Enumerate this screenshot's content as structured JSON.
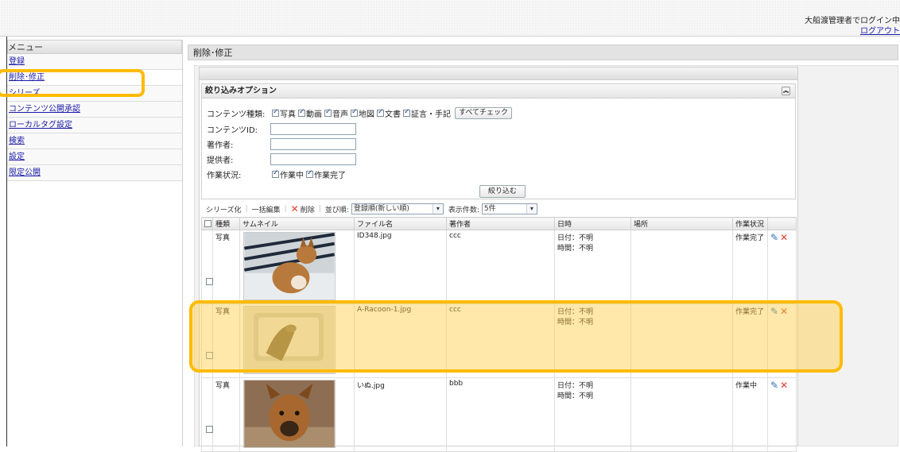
{
  "header": {
    "login_text": "大船渡管理者でログイン中",
    "logout_label": "ログアウト"
  },
  "sidebar": {
    "title": "メニュー",
    "items": [
      {
        "label": "登録"
      },
      {
        "label": "削除･修正"
      },
      {
        "label": "シリーズ"
      },
      {
        "label": "コンテンツ公開承認"
      },
      {
        "label": "ローカルタグ設定"
      },
      {
        "label": "検索"
      },
      {
        "label": "設定"
      },
      {
        "label": "限定公開"
      }
    ]
  },
  "main": {
    "title": "削除･修正"
  },
  "filter": {
    "title": "絞り込みオプション",
    "content_type_label": "コンテンツ種類:",
    "content_types": [
      "写真",
      "動画",
      "音声",
      "地図",
      "文書",
      "証言・手記"
    ],
    "check_all_label": "すべてチェック",
    "content_id_label": "コンテンツID:",
    "author_label": "著作者:",
    "provider_label": "提供者:",
    "status_label": "作業状況:",
    "status_options": [
      "作業中",
      "作業完了"
    ],
    "submit_label": "絞り込む"
  },
  "toolbar": {
    "series_label": "シリーズ化",
    "bulk_edit_label": "一括編集",
    "delete_label": "削除",
    "sort_label": "並び順:",
    "sort_value": "登録順(新しい順)",
    "count_label": "表示件数:",
    "count_value": "5件"
  },
  "table": {
    "columns": [
      "種類",
      "サムネイル",
      "ファイル名",
      "著作者",
      "日時",
      "場所",
      "作業状況"
    ],
    "rows": [
      {
        "type": "写真",
        "filename": "ID348.jpg",
        "author": "ccc",
        "date": "日付：不明",
        "time": "時間：不明",
        "place": "",
        "status": "作業完了"
      },
      {
        "type": "写真",
        "filename": "A-Racoon-1.jpg",
        "author": "ccc",
        "date": "日付：不明",
        "time": "時間：不明",
        "place": "",
        "status": "作業完了"
      },
      {
        "type": "写真",
        "filename": "いぬ.jpg",
        "author": "bbb",
        "date": "日付：不明",
        "time": "時間：不明",
        "place": "",
        "status": "作業中"
      }
    ]
  },
  "colors": {
    "highlight": "#ffbb00",
    "link": "#1a1aa8",
    "delete": "#e23d28"
  }
}
